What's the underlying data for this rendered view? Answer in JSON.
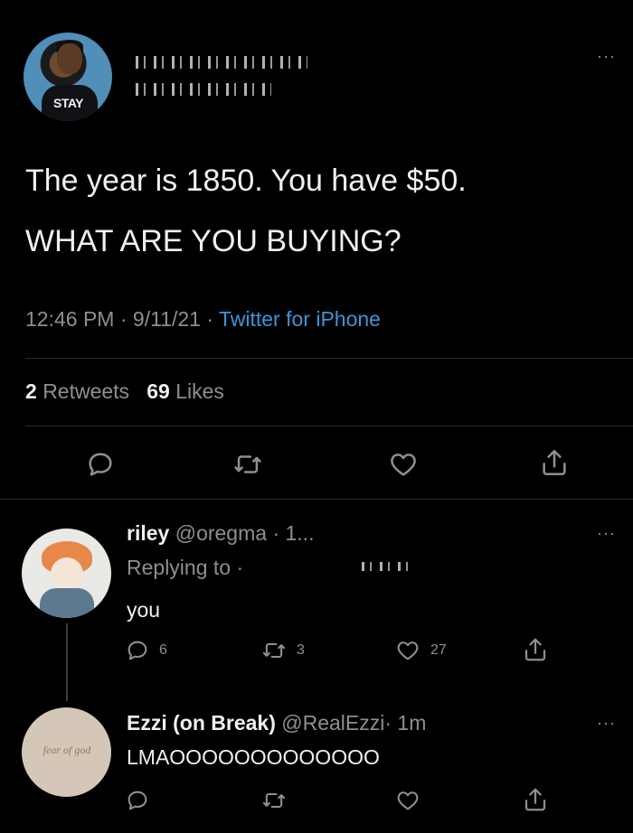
{
  "main_tweet": {
    "text_line1": "The year is 1850. You have $50.",
    "text_line2": "WHAT ARE YOU BUYING?",
    "time": "12:46 PM",
    "date": "9/11/21",
    "sep": "·",
    "client": "Twitter for iPhone",
    "retweets_count": "2",
    "retweets_label": "Retweets",
    "likes_count": "69",
    "likes_label": "Likes",
    "avatar_shirt_text": "STAY"
  },
  "more_label": "···",
  "replies": [
    {
      "name": "riley",
      "handle": "@oregma",
      "time": "· 1...",
      "replying_to_label": "Replying to",
      "text": "you",
      "reply_count": "6",
      "retweet_count": "3",
      "like_count": "27"
    },
    {
      "name": "Ezzi (on Break)",
      "handle": "@RealEzzi",
      "time": "· 1m",
      "text": "LMAOOOOOOOOOOOOO",
      "avatar_logo_text": "fear of god"
    }
  ],
  "icons": [
    "reply-icon",
    "retweet-icon",
    "like-icon",
    "share-icon",
    "more-icon"
  ],
  "colors": {
    "background": "#000000",
    "link": "#3b94d9",
    "muted": "#8b8f94",
    "text": "#f0f0f0"
  }
}
